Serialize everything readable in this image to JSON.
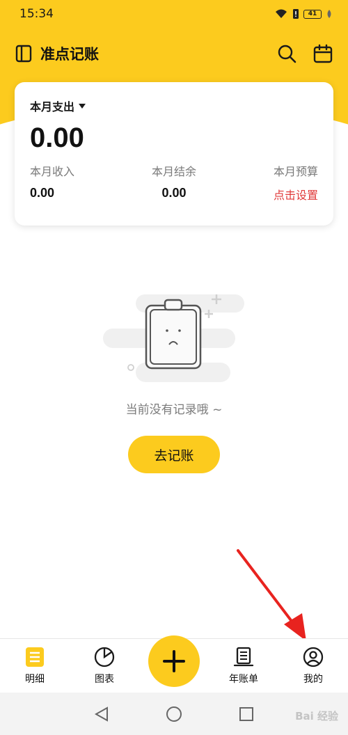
{
  "status_bar": {
    "time": "15:34",
    "battery": "41"
  },
  "header": {
    "title": "准点记账"
  },
  "summary": {
    "month_selector": "本月支出",
    "expense_total": "0.00",
    "income_label": "本月收入",
    "income_value": "0.00",
    "balance_label": "本月结余",
    "balance_value": "0.00",
    "budget_label": "本月预算",
    "budget_action": "点击设置"
  },
  "empty_state": {
    "message": "当前没有记录哦 ~",
    "action_label": "去记账"
  },
  "tabs": [
    {
      "label": "明细",
      "icon": "list-icon",
      "active": true
    },
    {
      "label": "图表",
      "icon": "pie-chart-icon",
      "active": false
    },
    {
      "label": "年账单",
      "icon": "bill-icon",
      "active": false
    },
    {
      "label": "我的",
      "icon": "profile-icon",
      "active": false
    }
  ],
  "colors": {
    "accent": "#FCCB1E",
    "link_red": "#E03A3A",
    "annotation_red": "#E8231F"
  },
  "watermark": "Bai 经验"
}
